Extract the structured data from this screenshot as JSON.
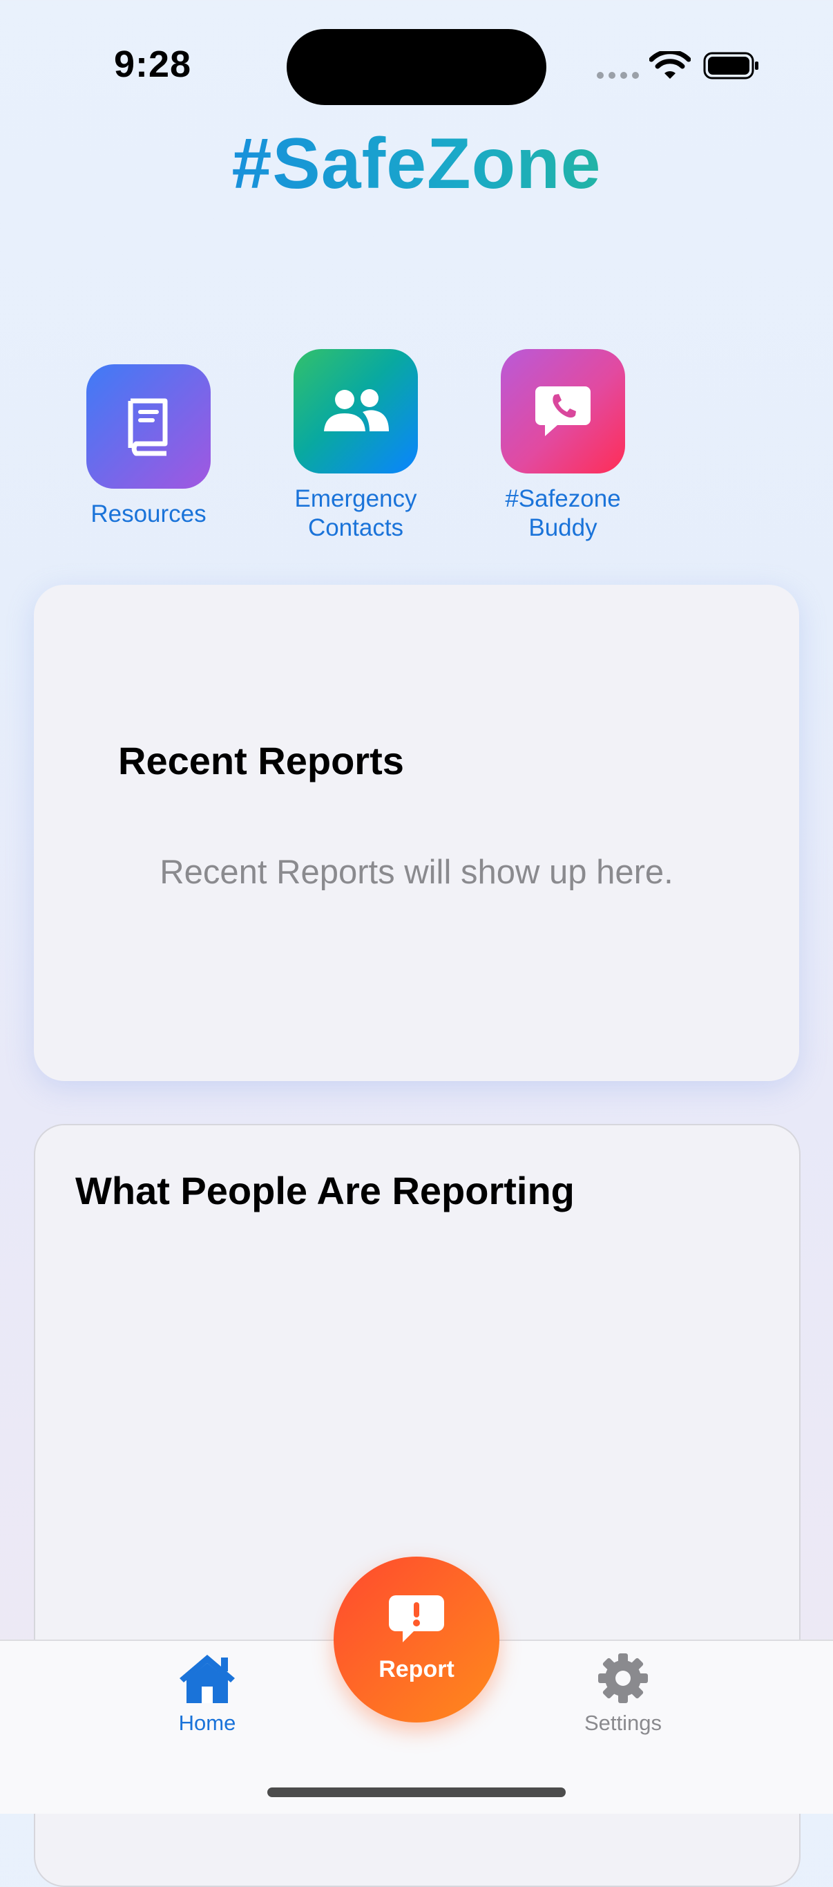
{
  "status_bar": {
    "time": "9:28"
  },
  "header": {
    "title": "#SafeZone"
  },
  "shortcuts": [
    {
      "label": "Resources",
      "icon": "book-icon"
    },
    {
      "label_line1": "Emergency",
      "label_line2": "Contacts",
      "icon": "people-icon"
    },
    {
      "label_line1": "#Safezone",
      "label_line2": "Buddy",
      "icon": "phone-bubble-icon"
    }
  ],
  "recent_reports": {
    "title": "Recent Reports",
    "empty_text": "Recent Reports will show up here."
  },
  "people_reporting": {
    "title": "What People Are Reporting"
  },
  "tab_bar": {
    "home_label": "Home",
    "report_label": "Report",
    "settings_label": "Settings"
  },
  "colors": {
    "accent": "#1a73d9",
    "report": "#ff6a26",
    "inactive": "#8a8a8e"
  }
}
